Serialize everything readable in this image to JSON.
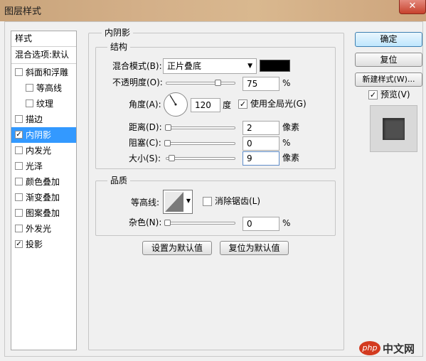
{
  "window": {
    "title": "图层样式",
    "close_label": "✕"
  },
  "style_list": {
    "header": "样式",
    "blend_options": "混合选项:默认",
    "items": [
      {
        "label": "斜面和浮雕",
        "checked": false,
        "selected": false,
        "indent": false
      },
      {
        "label": "等高线",
        "checked": false,
        "selected": false,
        "indent": true
      },
      {
        "label": "纹理",
        "checked": false,
        "selected": false,
        "indent": true
      },
      {
        "label": "描边",
        "checked": false,
        "selected": false,
        "indent": false
      },
      {
        "label": "内阴影",
        "checked": true,
        "selected": true,
        "indent": false
      },
      {
        "label": "内发光",
        "checked": false,
        "selected": false,
        "indent": false
      },
      {
        "label": "光泽",
        "checked": false,
        "selected": false,
        "indent": false
      },
      {
        "label": "颜色叠加",
        "checked": false,
        "selected": false,
        "indent": false
      },
      {
        "label": "渐变叠加",
        "checked": false,
        "selected": false,
        "indent": false
      },
      {
        "label": "图案叠加",
        "checked": false,
        "selected": false,
        "indent": false
      },
      {
        "label": "外发光",
        "checked": false,
        "selected": false,
        "indent": false
      },
      {
        "label": "投影",
        "checked": true,
        "selected": false,
        "indent": false
      }
    ]
  },
  "panel": {
    "title": "内阴影",
    "structure": {
      "title": "结构",
      "blend_mode_label": "混合模式(B):",
      "blend_mode_value": "正片叠底",
      "color": "#000000",
      "opacity_label": "不透明度(O):",
      "opacity_value": "75",
      "opacity_fraction": 0.75,
      "percent": "%",
      "angle_label": "角度(A):",
      "angle_value": "120",
      "angle_unit": "度",
      "use_global_light": "使用全局光(G)",
      "use_global_light_checked": true,
      "distance_label": "距离(D):",
      "distance_value": "2",
      "pixels": "像素",
      "choke_label": "阻塞(C):",
      "choke_value": "0",
      "size_label": "大小(S):",
      "size_value": "9"
    },
    "quality": {
      "title": "品质",
      "contour_label": "等高线:",
      "anti_alias": "消除锯齿(L)",
      "anti_alias_checked": false,
      "noise_label": "杂色(N):",
      "noise_value": "0"
    },
    "make_default": "设置为默认值",
    "reset_default": "复位为默认值"
  },
  "right": {
    "ok": "确定",
    "reset": "复位",
    "new_style": "新建样式(W)...",
    "preview": "预览(V)",
    "preview_checked": true
  },
  "watermark": {
    "site": "php",
    "text": "中文网"
  }
}
